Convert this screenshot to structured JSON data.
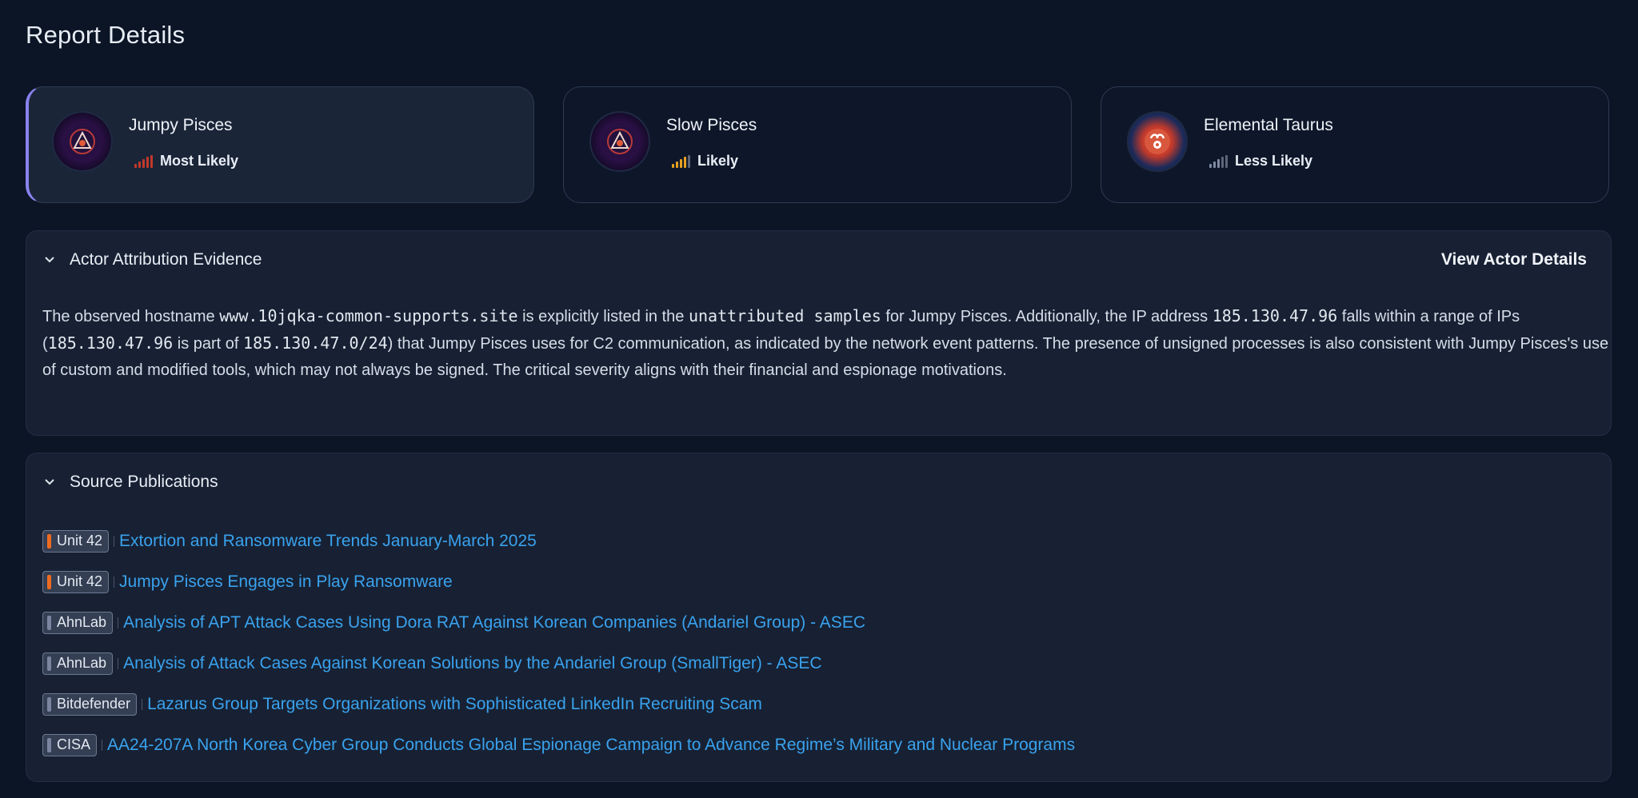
{
  "page": {
    "title": "Report Details"
  },
  "actors": [
    {
      "name": "Jumpy Pisces",
      "likelihood": "Most Likely",
      "signal_color": "#c0392b",
      "selected": true
    },
    {
      "name": "Slow Pisces",
      "likelihood": "Likely",
      "signal_color": "#e8a020",
      "selected": false
    },
    {
      "name": "Elemental Taurus",
      "likelihood": "Less Likely",
      "signal_color": "#7f8aa3",
      "selected": false
    }
  ],
  "evidence_panel": {
    "title": "Actor Attribution Evidence",
    "action_label": "View Actor Details",
    "text": {
      "p1": "The observed hostname ",
      "hostname": "www.10jqka-common-supports.site",
      "p2": " is explicitly listed in the ",
      "samples": "unattributed samples",
      "p3": " for Jumpy Pisces. Additionally, the IP address ",
      "ip": "185.130.47.96",
      "p4": " falls within a range of IPs (",
      "ip2": "185.130.47.96",
      "p5": " is part of ",
      "cidr": "185.130.47.0/24",
      "p6": ") that Jumpy Pisces uses for C2 communication, as indicated by the network event patterns. The presence of unsigned processes is also consistent with Jumpy Pisces's use of custom and modified tools, which may not always be signed. The critical severity aligns with their financial and espionage motivations."
    }
  },
  "publications_panel": {
    "title": "Source Publications",
    "items": [
      {
        "source": "Unit 42",
        "title": "Extortion and Ransomware Trends January-March 2025",
        "accent": "orange"
      },
      {
        "source": "Unit 42",
        "title": "Jumpy Pisces Engages in Play Ransomware",
        "accent": "orange"
      },
      {
        "source": "AhnLab",
        "title": "Analysis of APT Attack Cases Using Dora RAT Against Korean Companies (Andariel Group) - ASEC",
        "accent": "gray"
      },
      {
        "source": "AhnLab",
        "title": "Analysis of Attack Cases Against Korean Solutions by the Andariel Group (SmallTiger) - ASEC",
        "accent": "gray"
      },
      {
        "source": "Bitdefender",
        "title": "Lazarus Group Targets Organizations with Sophisticated LinkedIn Recruiting Scam",
        "accent": "gray"
      },
      {
        "source": "CISA",
        "title": "AA24-207A North Korea Cyber Group Conducts Global Espionage Campaign to Advance Regime’s Military and Nuclear Programs",
        "accent": "gray"
      }
    ]
  }
}
